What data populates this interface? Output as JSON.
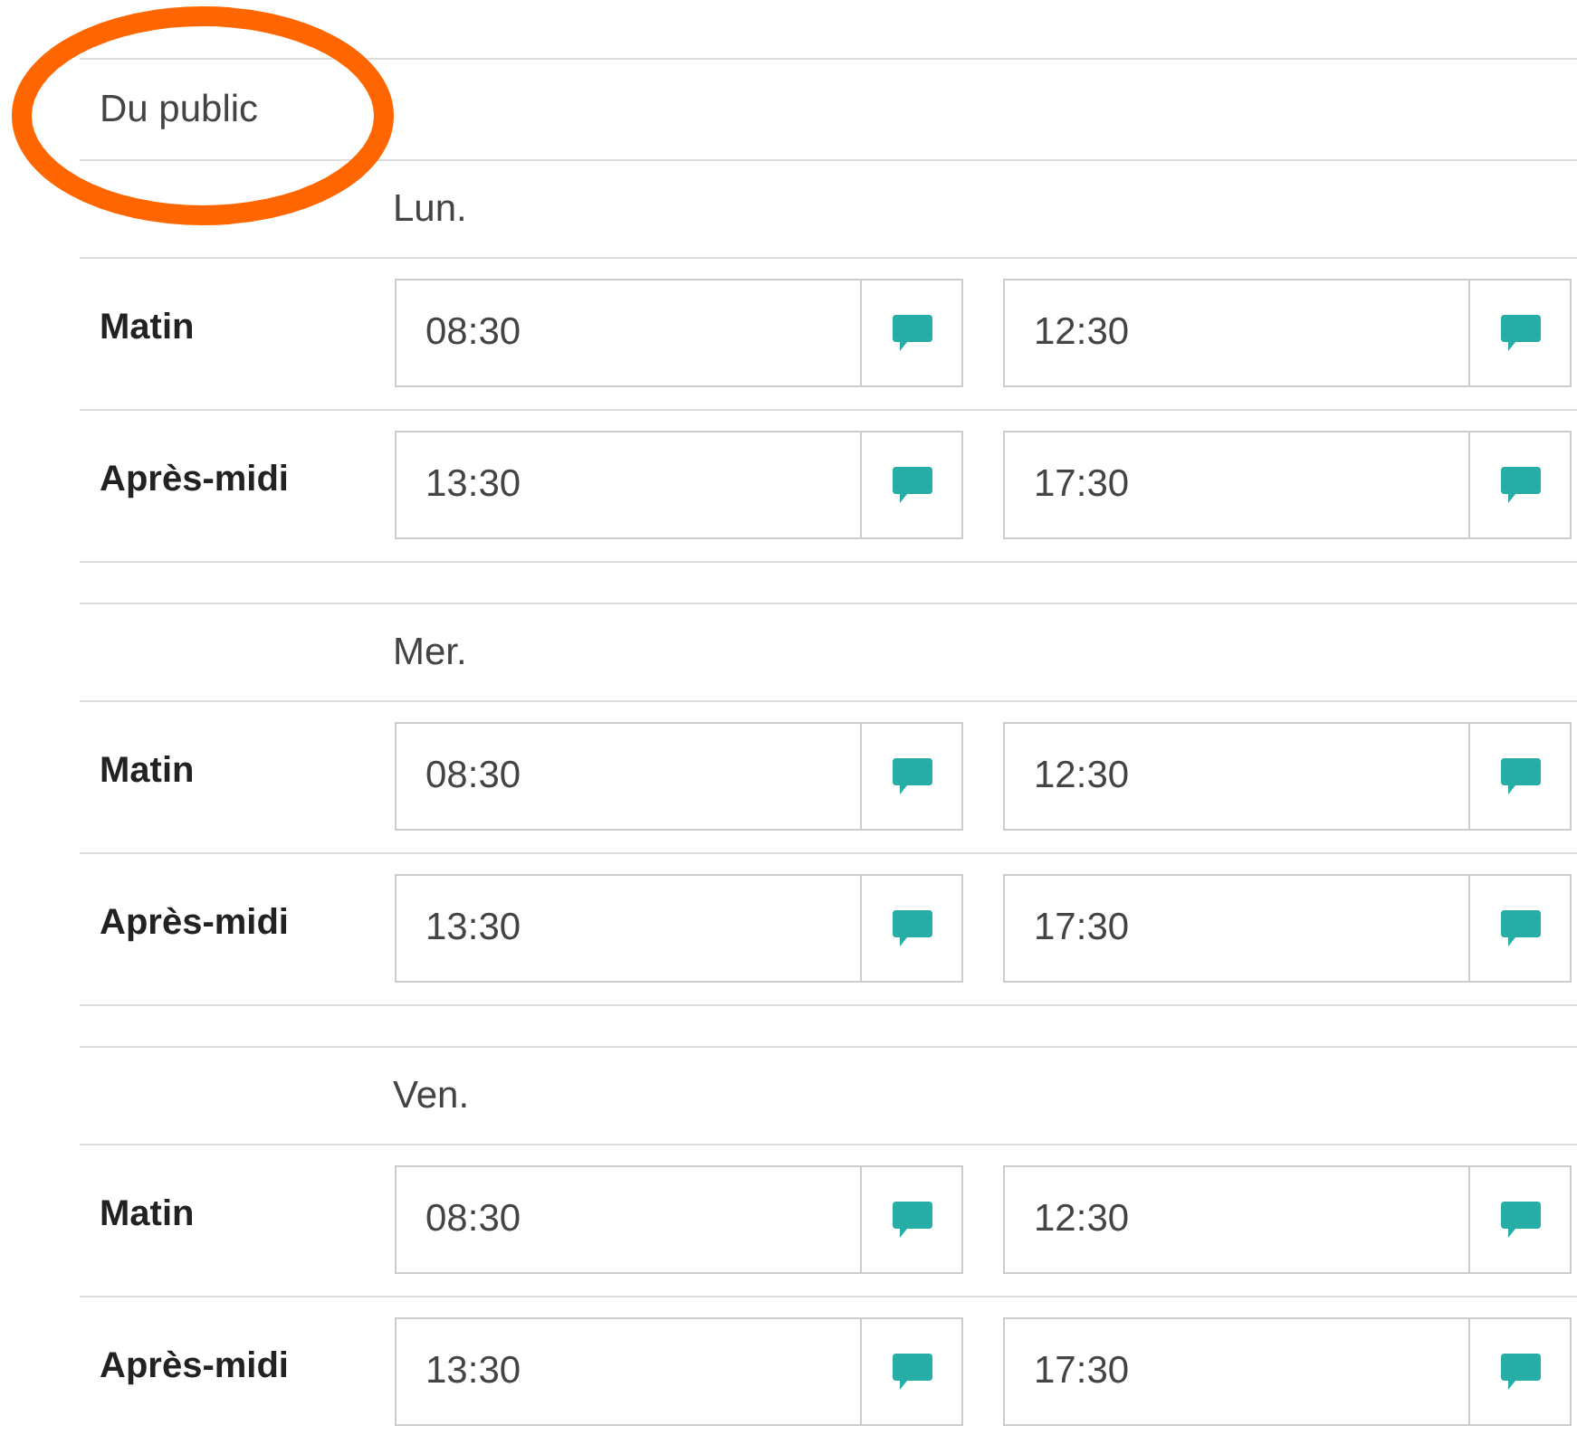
{
  "section": {
    "title": "Du public",
    "highlighted": true
  },
  "days": [
    {
      "name": "Lun.",
      "periods": [
        {
          "label": "Matin",
          "start": "08:30",
          "end": "12:30"
        },
        {
          "label": "Après-midi",
          "start": "13:30",
          "end": "17:30"
        }
      ]
    },
    {
      "name": "Mer.",
      "periods": [
        {
          "label": "Matin",
          "start": "08:30",
          "end": "12:30"
        },
        {
          "label": "Après-midi",
          "start": "13:30",
          "end": "17:30"
        }
      ]
    },
    {
      "name": "Ven.",
      "periods": [
        {
          "label": "Matin",
          "start": "08:30",
          "end": "12:30"
        },
        {
          "label": "Après-midi",
          "start": "13:30",
          "end": "17:30"
        }
      ]
    }
  ]
}
